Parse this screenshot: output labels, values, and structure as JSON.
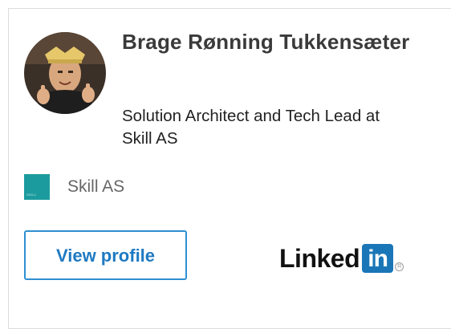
{
  "profile": {
    "name": "Brage Rønning Tukkensæter",
    "headline": "Solution Architect and Tech Lead at Skill AS",
    "company": "Skill AS",
    "company_logo_text": "SKILL"
  },
  "actions": {
    "view_profile_label": "View profile"
  },
  "branding": {
    "linkedin_text": "Linked",
    "linkedin_box_text": "in",
    "registered_mark": "R"
  },
  "colors": {
    "button_border": "#2e8fd1",
    "button_text": "#1f7ac2",
    "company_logo": "#1c9b9e",
    "linkedin_blue": "#1a76b7"
  },
  "icons": {
    "avatar": "profile-photo",
    "company": "company-logo-square",
    "brand": "linkedin-logo"
  }
}
